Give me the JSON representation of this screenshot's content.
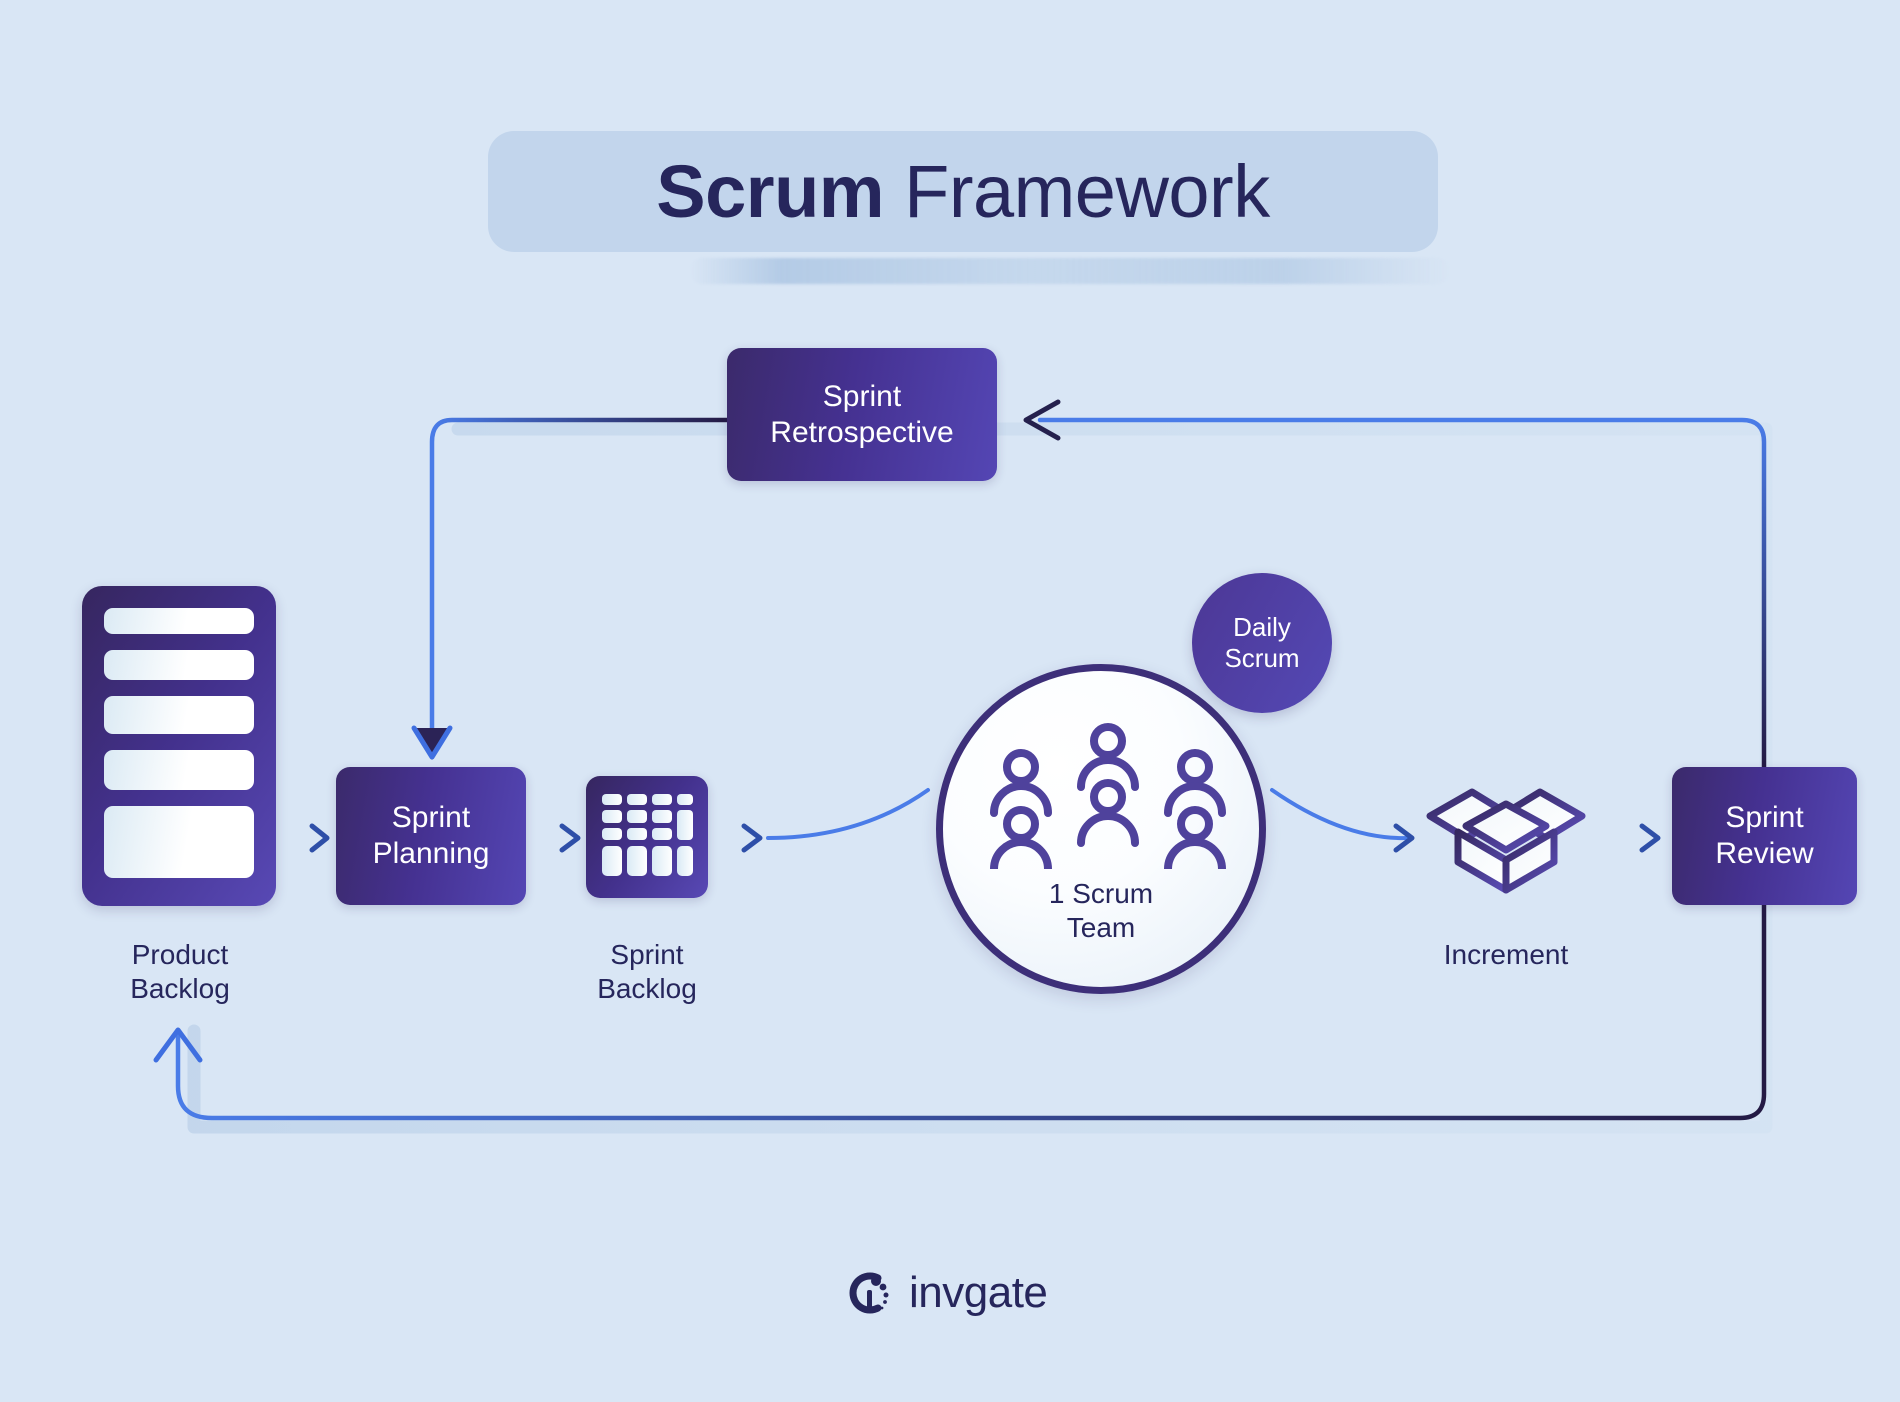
{
  "title": {
    "strong": "Scrum",
    "light": " Framework"
  },
  "colors": {
    "background": "#d9e6f5",
    "title_pill": "#c2d5ec",
    "navy_text": "#26265c",
    "purple_dark": "#36265f",
    "purple_mid": "#43318d",
    "purple_light": "#5849b5",
    "line_blue": "#3f6fe0",
    "line_navy": "#241a44",
    "circle_border": "#3d2f79"
  },
  "nodes": {
    "product_backlog": {
      "label_line1": "Product",
      "label_line2": "Backlog",
      "icon": "stacked-list-icon"
    },
    "sprint_planning": {
      "label_line1": "Sprint",
      "label_line2": "Planning"
    },
    "sprint_backlog": {
      "label_line1": "Sprint",
      "label_line2": "Backlog",
      "icon": "grid-cards-icon"
    },
    "scrum_team": {
      "label_line1": "1 Scrum",
      "label_line2": "Team",
      "icon": "people-group-icon",
      "people_count": 6
    },
    "daily_scrum": {
      "label_line1": "Daily",
      "label_line2": "Scrum"
    },
    "increment": {
      "label": "Increment",
      "icon": "open-box-icon"
    },
    "sprint_review": {
      "label_line1": "Sprint",
      "label_line2": "Review"
    },
    "sprint_retrospective": {
      "label_line1": "Sprint",
      "label_line2": "Retrospective"
    }
  },
  "footer": {
    "logo_word": "invgate",
    "logo_mark": "invgate-swirl-icon"
  }
}
